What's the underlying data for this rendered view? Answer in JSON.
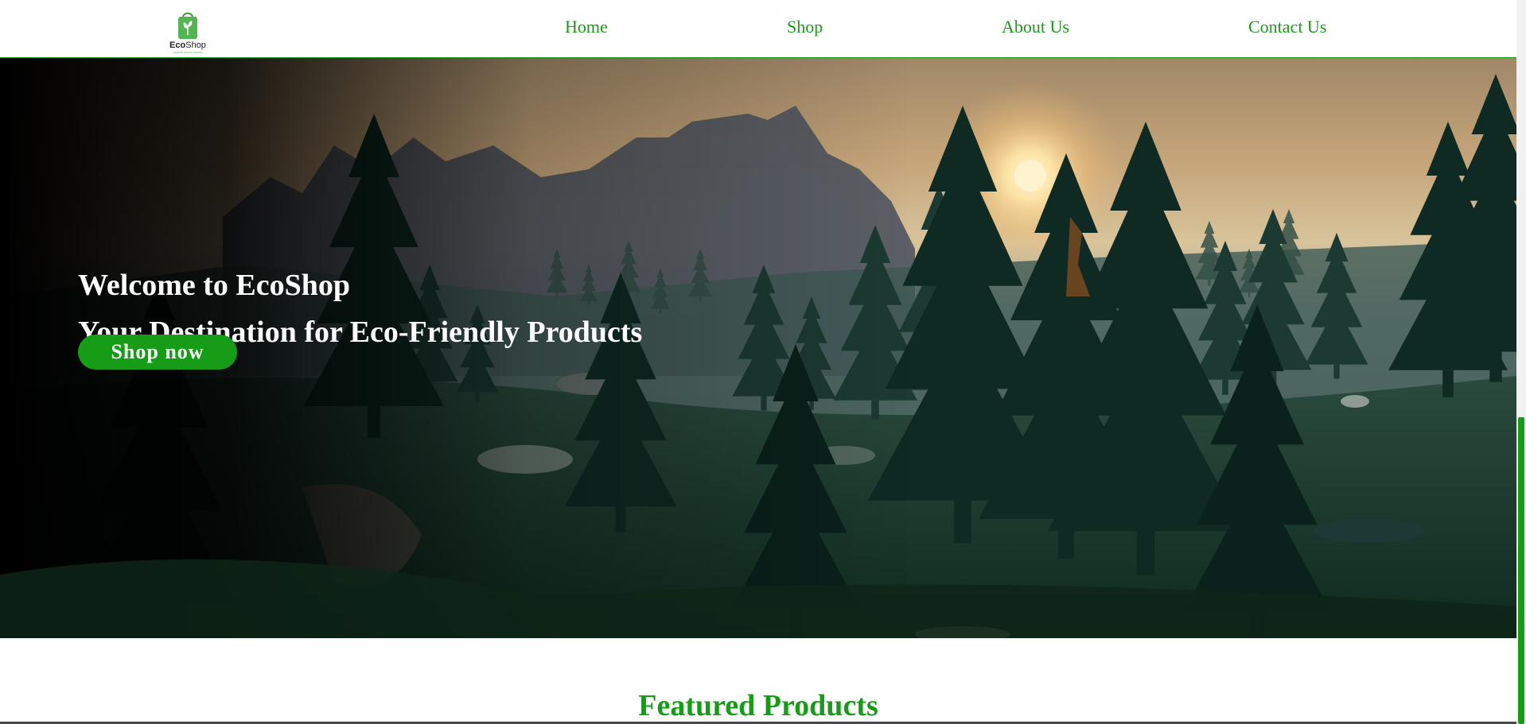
{
  "brand": {
    "name_part1": "Eco",
    "name_part2": "Shop",
    "tagline": "natural goods market",
    "accent_color": "#169c16"
  },
  "nav": {
    "items": [
      {
        "label": "Home"
      },
      {
        "label": "Shop"
      },
      {
        "label": "About Us"
      },
      {
        "label": "Contact Us"
      }
    ]
  },
  "hero": {
    "title": "Welcome to EcoShop",
    "subtitle": "Your Destination for Eco-Friendly Products",
    "cta_label": "Shop now",
    "background": "forest-sunset-mountain-photo"
  },
  "featured": {
    "title": "Featured Products"
  },
  "icons": {
    "logo": "shopping-bag-leaf-icon"
  }
}
